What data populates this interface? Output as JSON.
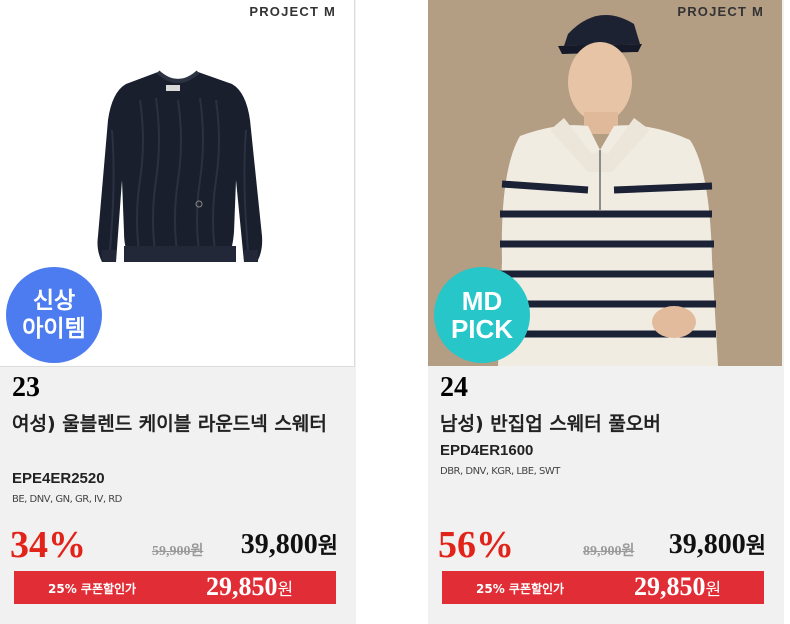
{
  "products": [
    {
      "brand": "PROJECT M",
      "badge": [
        "신상",
        "아이템"
      ],
      "rank": "23",
      "name": "여성) 울블렌드 케이블 라운드넥 스웨터",
      "code": "EPE4ER2520",
      "colors": "BE, DNV, GN, GR, IV, RD",
      "discount": "34%",
      "original_price": "59,900원",
      "sale_price": "39,800",
      "sale_currency": "원",
      "coupon_label": "25% 쿠폰할인가",
      "coupon_price": "29,850",
      "coupon_currency": "원"
    },
    {
      "brand": "PROJECT M",
      "badge": [
        "MD",
        "PICK"
      ],
      "rank": "24",
      "name": "남성) 반집업 스웨터 풀오버",
      "code": "EPD4ER1600",
      "colors": "DBR, DNV, KGR, LBE, SWT",
      "discount": "56%",
      "original_price": "89,900원",
      "sale_price": "39,800",
      "sale_currency": "원",
      "coupon_label": "25% 쿠폰할인가",
      "coupon_price": "29,850",
      "coupon_currency": "원"
    }
  ],
  "colors": {
    "badge_new": "#4d7cf0",
    "badge_md": "#27c6c9",
    "discount": "#e2231a",
    "coupon_bar": "#e12d35",
    "card_bg": "#f1f1f1"
  }
}
